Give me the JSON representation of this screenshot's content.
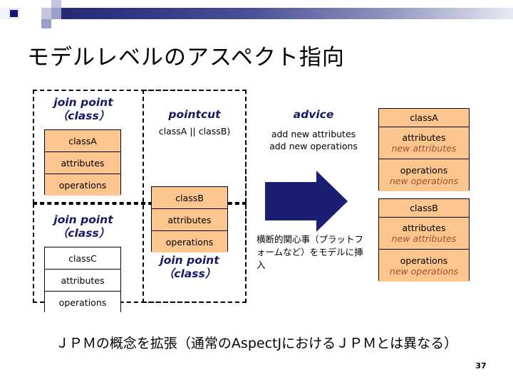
{
  "slide": {
    "title": "モデルレベルのアスペクト指向",
    "caption": "ＪＰＭの概念を拡張（通常のAspectJにおけるＪＰＭとは異なる）",
    "page_number": "37"
  },
  "theme": {
    "accent_navy": "#262a72",
    "label_navy": "#151a63",
    "class_fill": "#fbc58d",
    "added_text": "#a0522d",
    "arrow_fill": "#1a1f71"
  },
  "groups": {
    "joinpoint_top": {
      "label_line1": "join point",
      "label_line2": "（class）"
    },
    "joinpoint_bottom": {
      "label_line1": "join point",
      "label_line2": "（class）"
    },
    "joinpoint_mid": {
      "label_line1": "join point",
      "label_line2": "（class）"
    },
    "pointcut": {
      "label": "pointcut",
      "expression": "classA || classB)"
    },
    "advice": {
      "label": "advice",
      "line1": "add new attributes",
      "line2": "add new operations"
    }
  },
  "classes": {
    "classA_src": {
      "name": "classA",
      "attributes": "attributes",
      "operations": "operations"
    },
    "classB_src": {
      "name": "classB",
      "attributes": "attributes",
      "operations": "operations"
    },
    "classC_src": {
      "name": "classC",
      "attributes": "attributes",
      "operations": "operations"
    },
    "classA_out": {
      "name": "classA",
      "attributes": "attributes",
      "attributes_added": "new attributes",
      "operations": "operations",
      "operations_added": "new operations"
    },
    "classB_out": {
      "name": "classB",
      "attributes": "attributes",
      "attributes_added": "new attributes",
      "operations": "operations",
      "operations_added": "new operations"
    }
  },
  "annotations": {
    "crosscutting_note": "横断的関心事（プラットフォームなど）をモデルに挿入"
  },
  "icons": {
    "arrow": "right-arrow-icon"
  }
}
